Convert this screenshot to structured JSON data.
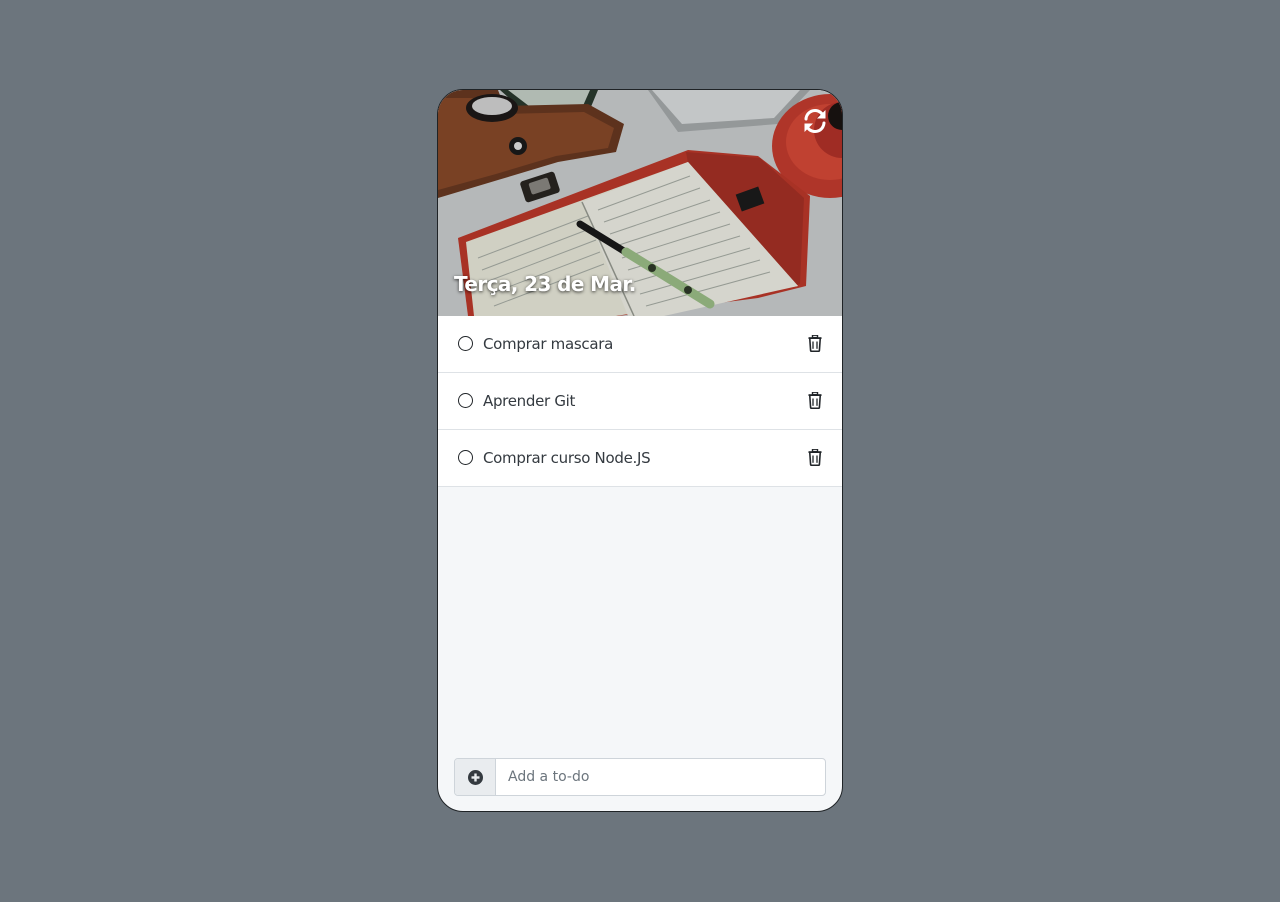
{
  "header": {
    "date": "Terça, 23 de Mar.",
    "refresh_icon": "sync-icon",
    "image_icon": "desk-notebook-photo"
  },
  "todos": [
    {
      "label": "Comprar mascara",
      "done": false
    },
    {
      "label": "Aprender Git",
      "done": false
    },
    {
      "label": "Comprar curso Node.JS",
      "done": false
    }
  ],
  "add": {
    "placeholder": "Add a to-do",
    "icon": "plus-circle-icon"
  },
  "colors": {
    "background": "#6c757d",
    "app_body": "#f5f7f9",
    "text": "#343a40"
  }
}
